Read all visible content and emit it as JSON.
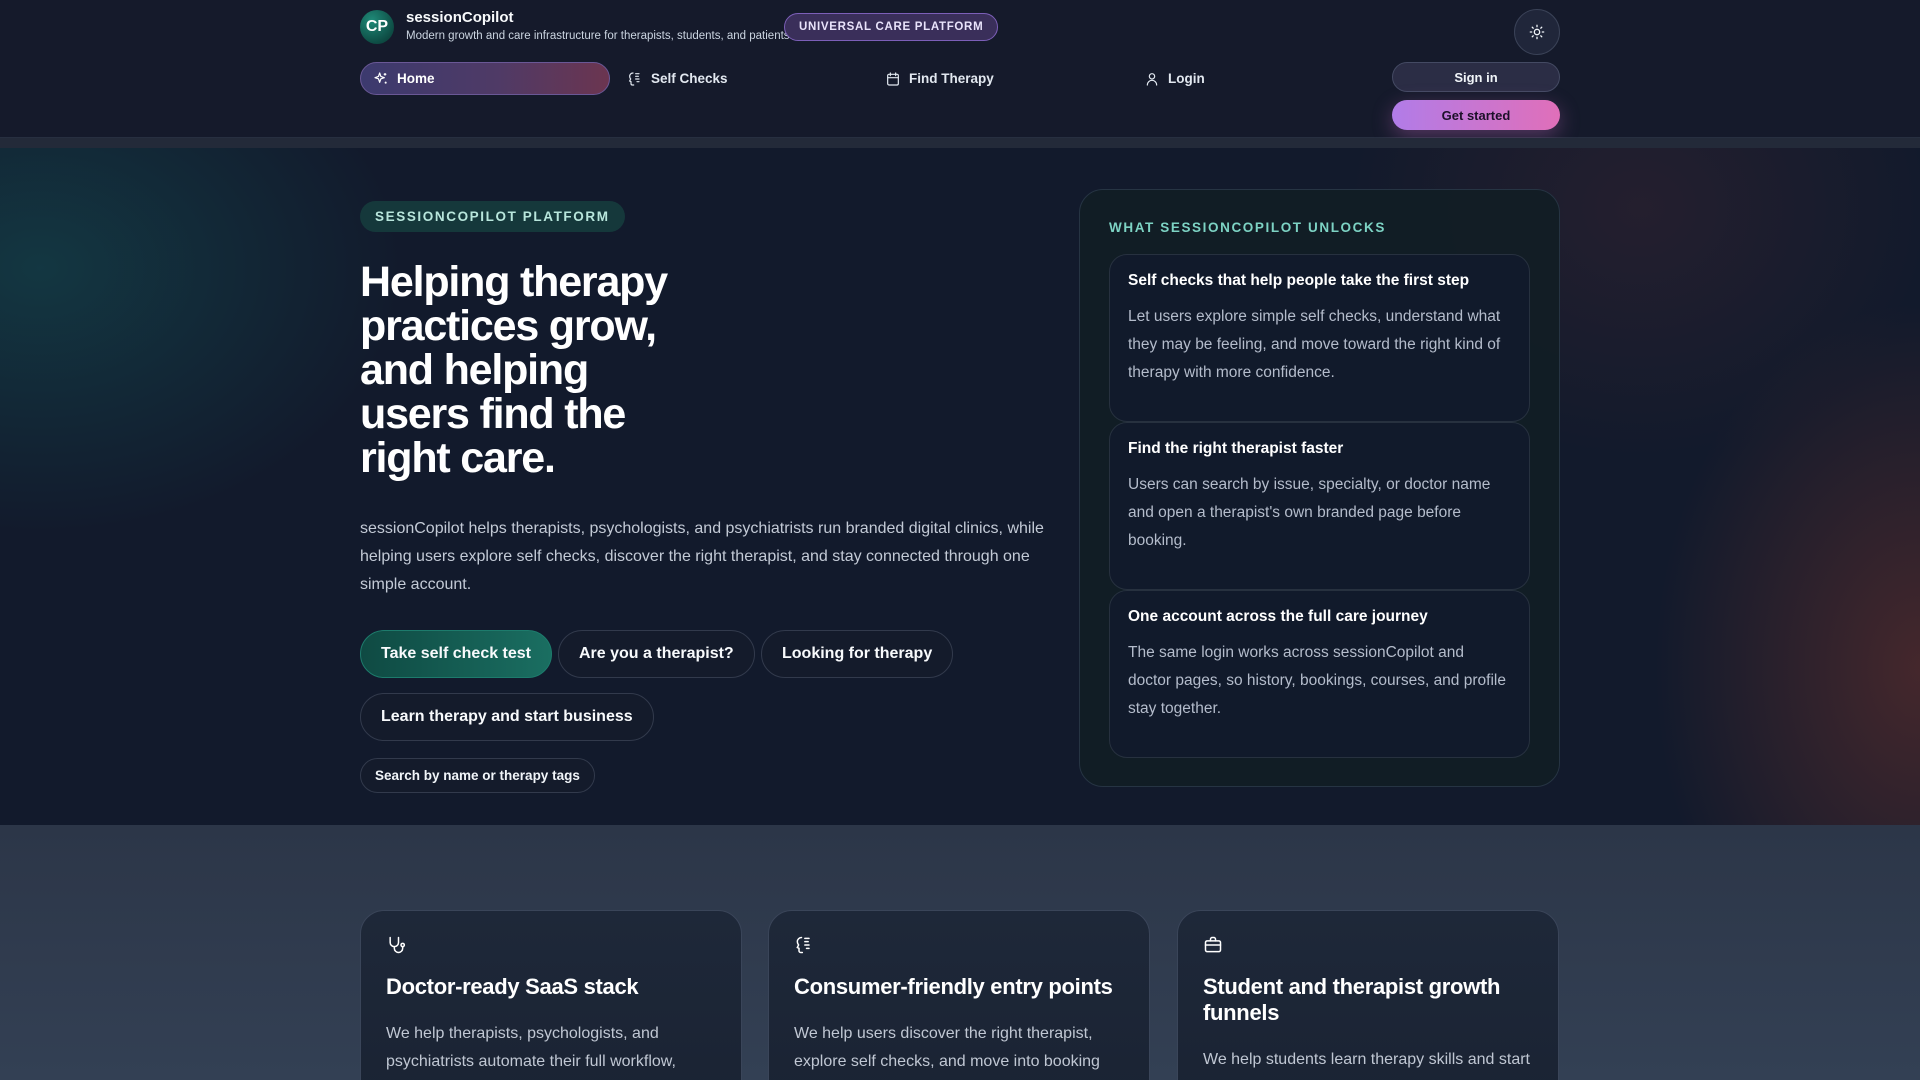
{
  "brand": {
    "logo_text": "CP",
    "name": "sessionCopilot",
    "tagline": "Modern growth and care infrastructure for therapists, students, and patients",
    "badge": "UNIVERSAL CARE PLATFORM"
  },
  "nav": {
    "items": [
      {
        "label": "Home",
        "icon": "sparkles-icon",
        "active": true
      },
      {
        "label": "Self Checks",
        "icon": "brain-icon",
        "active": false
      },
      {
        "label": "Find Therapy",
        "icon": "calendar-icon",
        "active": false
      },
      {
        "label": "Login",
        "icon": "user-icon",
        "active": false
      }
    ],
    "sign_in": "Sign in",
    "get_started": "Get started",
    "theme_toggle_icon": "sun-icon"
  },
  "hero": {
    "pill": "SESSIONCOPILOT PLATFORM",
    "title": "Helping therapy practices grow, and helping users find the right care.",
    "description": "sessionCopilot helps therapists, psychologists, and psychiatrists run branded digital clinics, while helping users explore self checks, discover the right therapist, and stay connected through one simple account.",
    "ctas": [
      "Take self check test",
      "Are you a therapist?",
      "Looking for therapy",
      "Learn therapy and start business"
    ],
    "search_chip": "Search by name or therapy tags"
  },
  "unlocks": {
    "title": "WHAT SESSIONCOPILOT UNLOCKS",
    "cards": [
      {
        "title": "Self checks that help people take the first step",
        "body": "Let users explore simple self checks, understand what they may be feeling, and move toward the right kind of therapy with more confidence."
      },
      {
        "title": "Find the right therapist faster",
        "body": "Users can search by issue, specialty, or doctor name and open a therapist's own branded page before booking."
      },
      {
        "title": "One account across the full care journey",
        "body": "The same login works across sessionCopilot and doctor pages, so history, bookings, courses, and profile stay together."
      }
    ]
  },
  "features": [
    {
      "icon": "stethoscope-icon",
      "title": "Doctor-ready SaaS stack",
      "body": "We help therapists, psychologists, and psychiatrists automate their full workflow,"
    },
    {
      "icon": "brain-icon",
      "title": "Consumer-friendly entry points",
      "body": "We help users discover the right therapist, explore self checks, and move into booking only"
    },
    {
      "icon": "briefcase-icon",
      "title": "Student and therapist growth funnels",
      "body": "We help students learn therapy skills and start"
    }
  ],
  "colors": {
    "accent_teal": "#1a6e61",
    "accent_purple": "#b17ce8",
    "accent_pink": "#e06fb9",
    "background": "#121a2c"
  }
}
